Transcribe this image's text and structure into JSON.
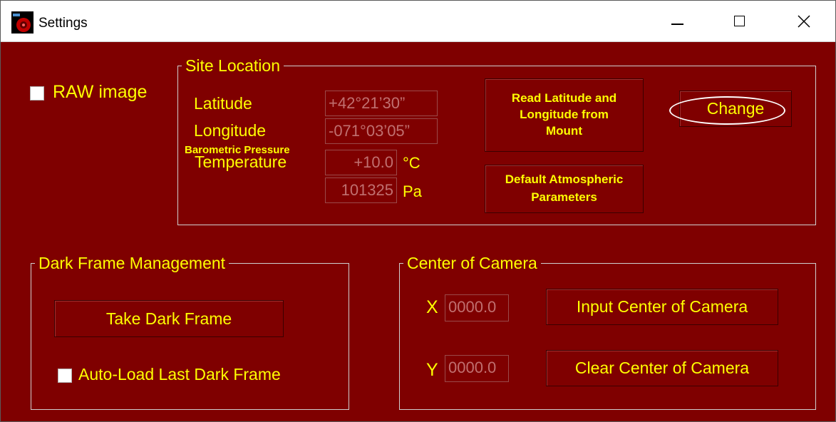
{
  "window": {
    "title": "Settings",
    "controls": {
      "minimize": "minimize",
      "maximize": "maximize",
      "close": "close"
    }
  },
  "raw_image": {
    "label": "RAW image",
    "checked": false
  },
  "site_location": {
    "title": "Site Location",
    "latitude_label": "Latitude",
    "latitude_value": "+42°21’30”",
    "longitude_label": "Longitude",
    "longitude_value": "-071°03’05”",
    "pressure_label": "Barometric Pressure",
    "temperature_label": "Temperature",
    "temperature_value": "+10.0",
    "temperature_unit": "°C",
    "pressure_value": "101325",
    "pressure_unit": "Pa",
    "read_button": "Read Latitude and Longitude from Mount",
    "change_button": "Change",
    "default_button": "Default Atmospheric Parameters"
  },
  "dark_frame": {
    "title": "Dark Frame Management",
    "take_button": "Take Dark Frame",
    "auto_load_label": "Auto-Load Last Dark Frame",
    "auto_load_checked": false
  },
  "center_camera": {
    "title": "Center of Camera",
    "x_label": "X",
    "x_value": "0000.0",
    "y_label": "Y",
    "y_value": "0000.0",
    "input_button": "Input Center of Camera",
    "clear_button": "Clear Center of Camera"
  },
  "colors": {
    "background": "#7f0000",
    "text": "#ffff00",
    "field_text": "#c07070",
    "titlebar": "#ffffff"
  },
  "icons": {
    "app": "camera-app-icon",
    "minimize": "minimize-icon",
    "maximize": "maximize-icon",
    "close": "close-icon"
  }
}
